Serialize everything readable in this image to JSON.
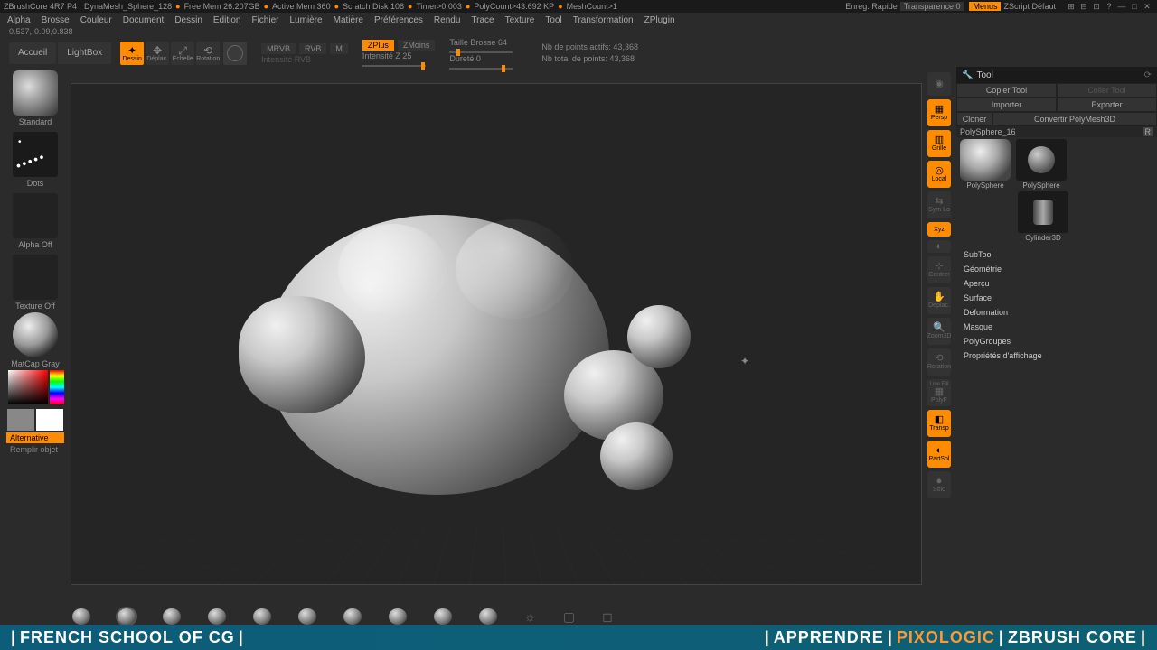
{
  "title": {
    "app": "ZBrushCore 4R7 P4",
    "doc": "DynaMesh_Sphere_128",
    "mem": "Free Mem 26.207GB",
    "active": "Active Mem 360",
    "scratch": "Scratch Disk 108",
    "timer": "Timer>0.003",
    "poly": "PolyCount>43.692 KP",
    "mesh": "MeshCount>1",
    "save": "Enreg. Rapide",
    "trans": "Transparence 0",
    "menus": "Menus",
    "script": "ZScript Défaut"
  },
  "menu": [
    "Alpha",
    "Brosse",
    "Couleur",
    "Document",
    "Dessin",
    "Edition",
    "Fichier",
    "Lumière",
    "Matière",
    "Préférences",
    "Rendu",
    "Trace",
    "Texture",
    "Tool",
    "Transformation",
    "ZPlugin"
  ],
  "coords": "0.537,-0.09,0.838",
  "toolbar": {
    "home": "Accueil",
    "lightbox": "LightBox",
    "draw": {
      "dessin": "Dessin",
      "deplac": "Déplac.",
      "echelle": "Echelle",
      "rotation": "Rotation"
    },
    "rgb": {
      "mrvb": "MRVB",
      "rvb": "RVB",
      "m": "M",
      "int": "Intensité RVB"
    },
    "z": {
      "zplus": "ZPlus",
      "zmoins": "ZMoins",
      "int": "Intensité Z 25"
    },
    "size": {
      "label": "Taille Brosse 64",
      "hard": "Dureté 0"
    },
    "stats": {
      "active": "Nb de points actifs: 43,368",
      "total": "Nb total de points: 43,368"
    }
  },
  "left": {
    "brush": "Standard",
    "stroke": "Dots",
    "alpha": "Alpha Off",
    "texture": "Texture Off",
    "material": "MatCap Gray",
    "alt": "Alternative",
    "fill": "Remplir objet"
  },
  "rightIcons": [
    "",
    "Persp",
    "Grille",
    "Local",
    "Sym Lo",
    "Xyz",
    "",
    "Centrer",
    "Déplac.",
    "Zoom3D",
    "Rotation",
    "Line Fill",
    "PolyF",
    "Transp",
    "PartSol",
    "Solo"
  ],
  "tool": {
    "header": "Tool",
    "copy": "Copier Tool",
    "paste": "Coller Tool",
    "import": "Importer",
    "export": "Exporter",
    "clone": "Cloner",
    "convert": "Convertir PolyMesh3D",
    "current": "PolySphere_16",
    "r": "R",
    "thumbs": [
      "PolySphere",
      "PolySphere",
      "Cylinder3D"
    ],
    "sections": [
      "SubTool",
      "Géométrie",
      "Aperçu",
      "Surface",
      "Deformation",
      "Masque",
      "PolyGroupes",
      "Propriétés d'affichage"
    ]
  },
  "footer": {
    "left": "FRENCH SCHOOL OF CG",
    "r1": "APPRENDRE",
    "r2": "PIXOLOGIC",
    "r3": "ZBRUSH CORE"
  }
}
